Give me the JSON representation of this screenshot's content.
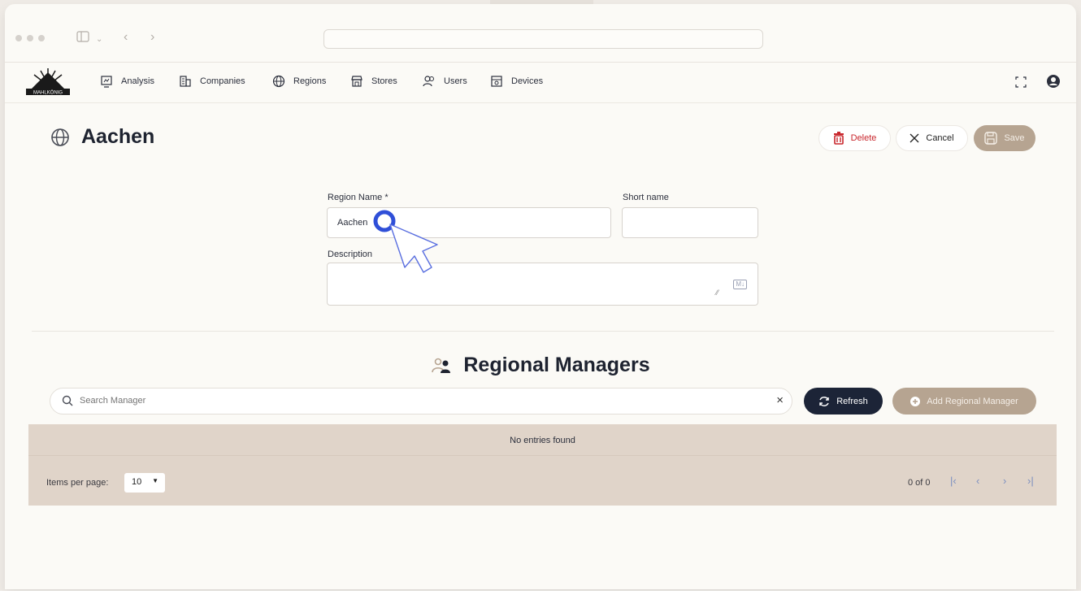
{
  "nav": {
    "items": [
      {
        "label": "Analysis",
        "icon": "analysis-icon"
      },
      {
        "label": "Companies",
        "icon": "companies-icon"
      },
      {
        "label": "Regions",
        "icon": "globe-icon"
      },
      {
        "label": "Stores",
        "icon": "store-icon"
      },
      {
        "label": "Users",
        "icon": "users-icon"
      },
      {
        "label": "Devices",
        "icon": "devices-icon"
      }
    ]
  },
  "logo": {
    "text": "MAHLKÖNIG"
  },
  "page": {
    "title": "Aachen"
  },
  "actions": {
    "delete": "Delete",
    "cancel": "Cancel",
    "save": "Save"
  },
  "form": {
    "region_name_label": "Region Name *",
    "region_name_value": "Aachen",
    "short_name_label": "Short name",
    "short_name_value": "",
    "description_label": "Description",
    "description_value": "",
    "markdown_badge": "M↓"
  },
  "managers": {
    "title": "Regional Managers",
    "search_placeholder": "Search Manager",
    "refresh": "Refresh",
    "add": "Add Regional Manager",
    "empty": "No entries found",
    "items_per_page_label": "Items per page:",
    "items_per_page": "10",
    "range": "0 of 0"
  },
  "colors": {
    "accent": "#b6a491",
    "dark": "#1c2437",
    "danger": "#c8262c",
    "table_bg": "#e0d4c9",
    "cursor": "#2f4fd8"
  }
}
